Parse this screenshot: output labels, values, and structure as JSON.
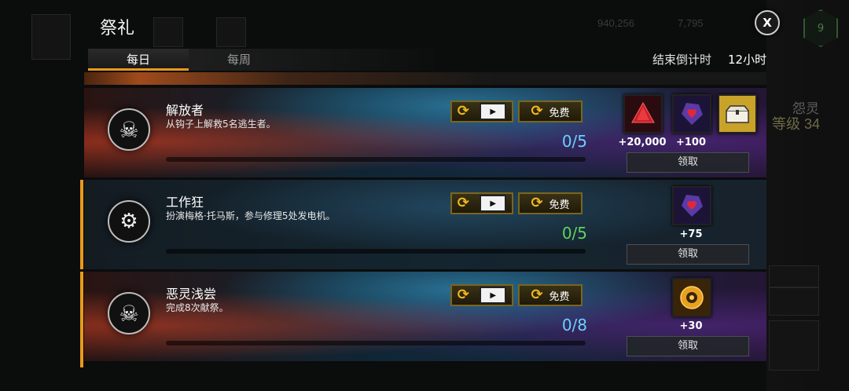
{
  "header": {
    "title": "祭礼",
    "close_label": "X",
    "level_badge": "9"
  },
  "background": {
    "currency1": "940,256",
    "currency2": "7,795",
    "side_label1": "怨灵",
    "side_label2": "等级 34"
  },
  "tabs": [
    {
      "label": "每日",
      "active": true
    },
    {
      "label": "每周",
      "active": false
    }
  ],
  "countdown": {
    "label": "结束倒计时",
    "value": "12小时"
  },
  "colors": {
    "accent": "#e89a1a",
    "progress_cyan": "#6ad0ff",
    "progress_green": "#5fd35f"
  },
  "rituals": [
    {
      "icon": "skull-hooks-icon",
      "title": "解放者",
      "description": "从钩子上解救5名逃生者。",
      "reroll_icons": [
        "reroll-icon",
        "video-icon"
      ],
      "free_label": "免费",
      "progress": "0/5",
      "rewards": [
        {
          "icon": "red-shard-icon",
          "amount": "+20,000"
        },
        {
          "icon": "purple-shard-icon",
          "amount": "+100"
        },
        {
          "icon": "chest-icon",
          "amount": ""
        }
      ],
      "claim_label": "领取"
    },
    {
      "icon": "generator-icon",
      "title": "工作狂",
      "description": "扮演梅格·托马斯，参与修理5处发电机。",
      "reroll_icons": [
        "reroll-icon",
        "video-icon"
      ],
      "free_label": "免费",
      "progress": "0/5",
      "rewards": [
        {
          "icon": "purple-shard-icon",
          "amount": "+75"
        }
      ],
      "claim_label": "领取"
    },
    {
      "icon": "skull-hooks-icon",
      "title": "恶灵浅尝",
      "description": "完成8次献祭。",
      "reroll_icons": [
        "reroll-icon",
        "video-icon"
      ],
      "free_label": "免费",
      "progress": "0/8",
      "rewards": [
        {
          "icon": "gold-cog-icon",
          "amount": "+30"
        }
      ],
      "claim_label": "领取"
    }
  ]
}
